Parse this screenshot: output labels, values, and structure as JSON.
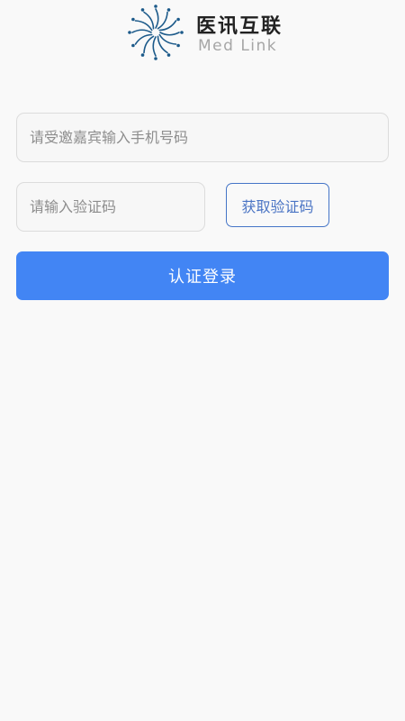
{
  "logo": {
    "title_cn": "医讯互联",
    "title_en": "Med Link",
    "icon": "starburst-logo-icon",
    "color": "#1c5a8a"
  },
  "form": {
    "phone_placeholder": "请受邀嘉宾输入手机号码",
    "code_placeholder": "请输入验证码",
    "get_code_label": "获取验证码",
    "login_label": "认证登录"
  },
  "colors": {
    "primary": "#4285f4",
    "outline_button": "#4575c7",
    "background": "#f9f9f9"
  }
}
